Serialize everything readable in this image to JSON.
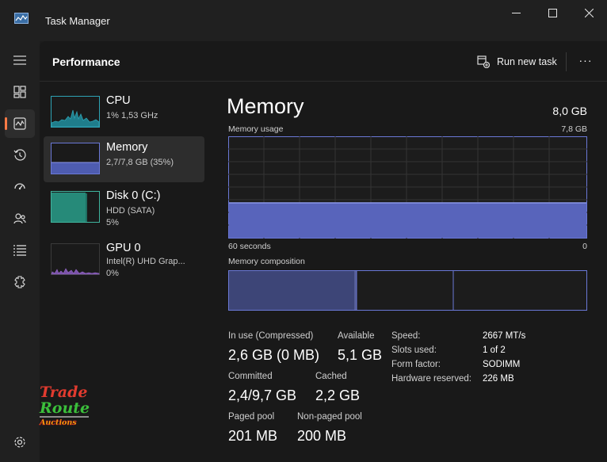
{
  "window": {
    "title": "Task Manager"
  },
  "header": {
    "page_title": "Performance",
    "run_new_task": "Run new task",
    "more_label": "···"
  },
  "nav": {
    "items": [
      "menu-icon",
      "processes-icon",
      "performance-icon",
      "app-history-icon",
      "startup-icon",
      "users-icon",
      "details-icon",
      "services-icon",
      "settings-icon"
    ]
  },
  "devices": [
    {
      "name": "CPU",
      "sub1": "1% 1,53 GHz",
      "sub2": ""
    },
    {
      "name": "Memory",
      "sub1": "2,7/7,8 GB (35%)",
      "sub2": ""
    },
    {
      "name": "Disk 0 (C:)",
      "sub1": "HDD (SATA)",
      "sub2": "5%"
    },
    {
      "name": "GPU 0",
      "sub1": "Intel(R) UHD Grap...",
      "sub2": "0%"
    }
  ],
  "memory": {
    "title": "Memory",
    "total": "8,0 GB",
    "usage_label": "Memory usage",
    "usage_max": "7,8 GB",
    "axis_left": "60 seconds",
    "axis_right": "0",
    "composition_label": "Memory composition",
    "usage_fraction": 0.35,
    "composition_fractions": {
      "in_use": 0.35,
      "modified": 0.005,
      "standby": 0.27,
      "free": 0.375
    },
    "stats": {
      "in_use_label": "In use (Compressed)",
      "in_use_value": "2,6 GB (0 MB)",
      "available_label": "Available",
      "available_value": "5,1 GB",
      "committed_label": "Committed",
      "committed_value": "2,4/9,7 GB",
      "cached_label": "Cached",
      "cached_value": "2,2 GB",
      "paged_label": "Paged pool",
      "paged_value": "201 MB",
      "nonpaged_label": "Non-paged pool",
      "nonpaged_value": "200 MB"
    },
    "props": [
      {
        "label": "Speed:",
        "value": "2667 MT/s"
      },
      {
        "label": "Slots used:",
        "value": "1 of 2"
      },
      {
        "label": "Form factor:",
        "value": "SODIMM"
      },
      {
        "label": "Hardware reserved:",
        "value": "226 MB"
      }
    ]
  },
  "watermark": {
    "line1": "Trade",
    "line2": "Route",
    "line3": "Auctions"
  },
  "colors": {
    "memory_accent": "#6a78d6",
    "cpu_accent": "#2ea3b4",
    "disk_accent": "#3fb39d",
    "gpu_accent": "#9a6bd0",
    "nav_indicator": "#ff7a45"
  }
}
